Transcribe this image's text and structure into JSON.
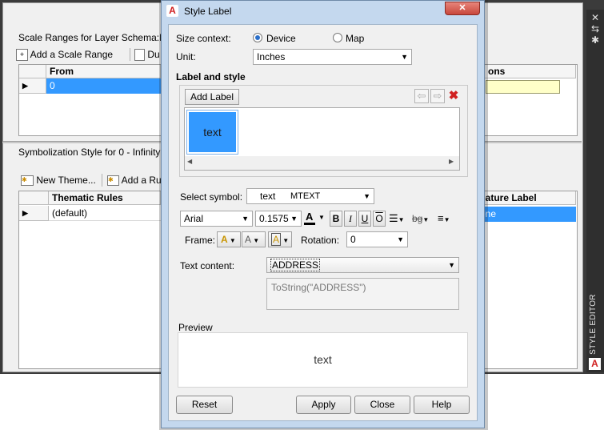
{
  "background": {
    "scale_section_title": "Scale Ranges for Layer Schema:Pa",
    "add_scale_range": "Add a Scale Range",
    "duplicate_label": "Du",
    "scale_table": {
      "col_from": "From",
      "row_from": "0",
      "col_right": "ons"
    },
    "symbolization_title": "Symbolization Style for 0 - Infinity",
    "new_theme": "New Theme...",
    "add_rule": "Add a Ru",
    "rules_table": {
      "col_rules": "Thematic Rules",
      "row_rules": "(default)",
      "col_feature_label": "eature Label",
      "row_feature_label": "one"
    },
    "sidebar_label": "STYLE EDITOR"
  },
  "dialog": {
    "title": "Style Label",
    "close_glyph": "✕",
    "size_context_label": "Size context:",
    "device_label": "Device",
    "map_label": "Map",
    "size_context_selected": "Device",
    "unit_label": "Unit:",
    "unit_value": "Inches",
    "label_and_style_title": "Label and style",
    "add_label_button": "Add Label",
    "label_tile_text": "text",
    "select_symbol_label": "Select symbol:",
    "symbol_preview": "text",
    "symbol_type": "MTEXT",
    "font_value": "Arial",
    "size_value": "0.1575",
    "bold": "B",
    "italic": "I",
    "underline": "U",
    "overline": "O",
    "background_glyph": "bg",
    "frame_label": "Frame:",
    "rotation_label": "Rotation:",
    "rotation_value": "0",
    "text_content_label": "Text content:",
    "text_content_value": "ADDRESS",
    "expression_value": "ToString(\"ADDRESS\")",
    "preview_label": "Preview",
    "preview_text": "text",
    "reset_button": "Reset",
    "apply_button": "Apply",
    "close_button": "Close",
    "help_button": "Help"
  },
  "colors": {
    "selection": "#3399ff",
    "tile": "#3399ff",
    "title_bar": "#c4d8ee",
    "close_button": "#c8473c",
    "accent_red": "#d02020"
  }
}
